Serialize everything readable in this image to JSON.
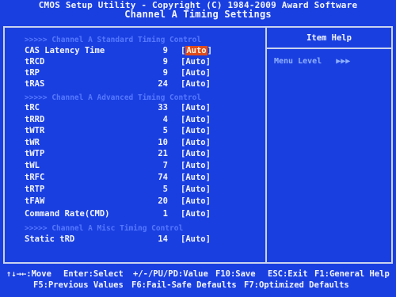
{
  "header": {
    "line1": "CMOS Setup Utility - Copyright (C) 1984-2009 Award Software",
    "line2": "Channel A Timing Settings"
  },
  "help_panel": {
    "title": "Item Help",
    "menu_level_label": "Menu Level",
    "menu_level_arrows": "▶▶▶"
  },
  "sections": {
    "standard": ">>>>>  Channel A Standard Timing Control",
    "advanced": ">>>>>  Channel A Advanced Timing Control",
    "misc": ">>>>>  Channel A Misc Timing Control"
  },
  "rows": [
    {
      "label": "CAS Latency Time",
      "value": "9",
      "setting": "Auto",
      "selected": true
    },
    {
      "label": "tRCD",
      "value": "9",
      "setting": "Auto"
    },
    {
      "label": "tRP",
      "value": "9",
      "setting": "Auto"
    },
    {
      "label": "tRAS",
      "value": "24",
      "setting": "Auto"
    },
    {
      "label": "tRC",
      "value": "33",
      "setting": "Auto"
    },
    {
      "label": "tRRD",
      "value": "4",
      "setting": "Auto"
    },
    {
      "label": "tWTR",
      "value": "5",
      "setting": "Auto"
    },
    {
      "label": "tWR",
      "value": "10",
      "setting": "Auto"
    },
    {
      "label": "tWTP",
      "value": "21",
      "setting": "Auto"
    },
    {
      "label": "tWL",
      "value": "7",
      "setting": "Auto"
    },
    {
      "label": "tRFC",
      "value": "74",
      "setting": "Auto"
    },
    {
      "label": "tRTP",
      "value": "5",
      "setting": "Auto"
    },
    {
      "label": "tFAW",
      "value": "20",
      "setting": "Auto"
    },
    {
      "label": "Command Rate(CMD)",
      "value": "1",
      "setting": "Auto"
    },
    {
      "label": "Static tRD",
      "value": "14",
      "setting": "Auto"
    }
  ],
  "footer": {
    "move": "↑↓→←:Move",
    "select": "Enter:Select",
    "value": "+/-/PU/PD:Value",
    "save": "F10:Save",
    "exit": "ESC:Exit",
    "help": "F1:General Help",
    "previous": "F5:Previous Values",
    "failsafe": "F6:Fail-Safe Defaults",
    "optimized": "F7:Optimized Defaults"
  },
  "colors": {
    "background": "#1a3fe0",
    "text": "#f2f5ff",
    "section_text": "#5578ff",
    "selected_highlight": "#e04a1a"
  }
}
